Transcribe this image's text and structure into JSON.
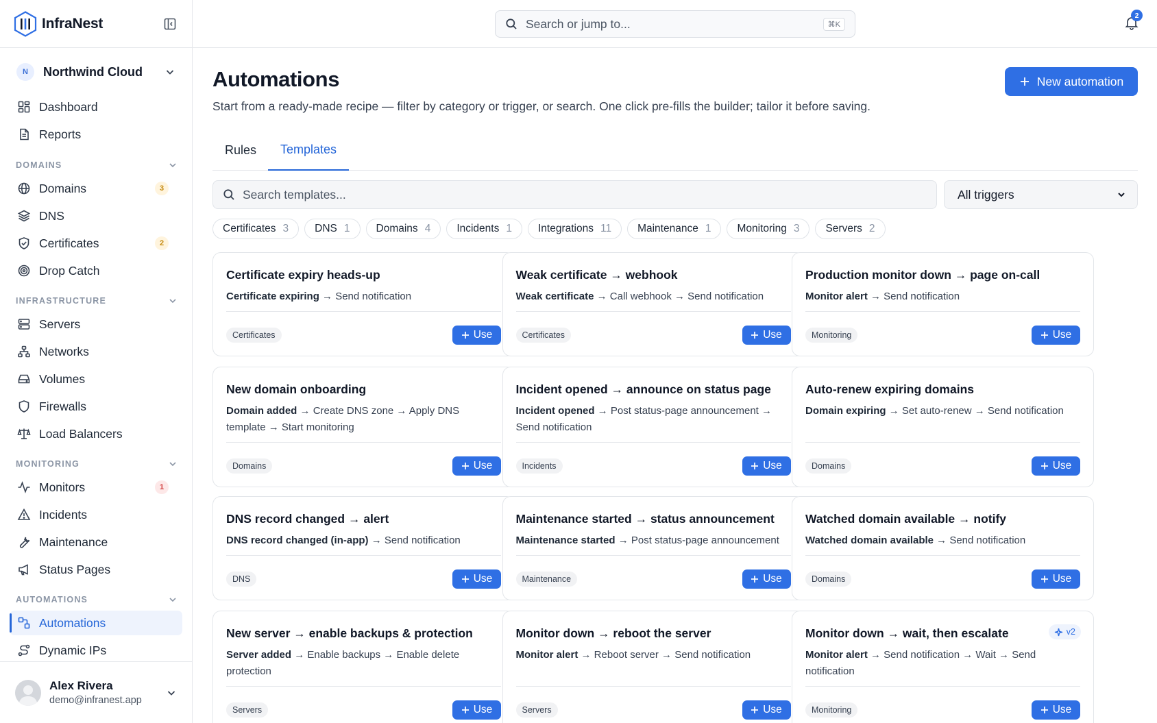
{
  "brand": {
    "name": "InfraNest"
  },
  "org": {
    "initial": "N",
    "name": "Northwind Cloud"
  },
  "nav": {
    "dashboard": "Dashboard",
    "reports": "Reports",
    "domains_section": "DOMAINS",
    "domains": "Domains",
    "domains_count": "3",
    "dns": "DNS",
    "certificates": "Certificates",
    "certificates_count": "2",
    "drop_catch": "Drop Catch",
    "infrastructure_section": "INFRASTRUCTURE",
    "servers": "Servers",
    "networks": "Networks",
    "volumes": "Volumes",
    "firewalls": "Firewalls",
    "load_balancers": "Load Balancers",
    "monitoring_section": "MONITORING",
    "monitors": "Monitors",
    "monitors_count": "1",
    "incidents": "Incidents",
    "maintenance": "Maintenance",
    "status_pages": "Status Pages",
    "automations_section": "AUTOMATIONS",
    "automations": "Automations",
    "dynamic_ips": "Dynamic IPs"
  },
  "user": {
    "name": "Alex Rivera",
    "email": "demo@infranest.app"
  },
  "topbar": {
    "search_placeholder": "Search or jump to...",
    "shortcut": "⌘K",
    "notifications_count": "2"
  },
  "page": {
    "title": "Automations",
    "subtitle": "Start from a ready-made recipe — filter by category or trigger, or search. One click pre-fills the builder; tailor it before saving.",
    "new_button": "New automation",
    "tabs": [
      "Rules",
      "Templates"
    ],
    "active_tab": "Templates",
    "template_search_placeholder": "Search templates...",
    "trigger_filter": "All triggers"
  },
  "chips": [
    {
      "label": "Certificates",
      "count": "3"
    },
    {
      "label": "DNS",
      "count": "1"
    },
    {
      "label": "Domains",
      "count": "4"
    },
    {
      "label": "Incidents",
      "count": "1"
    },
    {
      "label": "Integrations",
      "count": "11"
    },
    {
      "label": "Maintenance",
      "count": "1"
    },
    {
      "label": "Monitoring",
      "count": "3"
    },
    {
      "label": "Servers",
      "count": "2"
    }
  ],
  "use_label": "Use",
  "cards": [
    {
      "title": "Certificate expiry heads-up",
      "trigger": "Certificate expiring",
      "steps": " → Send notification",
      "tag": "Certificates"
    },
    {
      "title": "Weak certificate → webhook",
      "trigger": "Weak certificate",
      "steps": " → Call webhook → Send notification",
      "tag": "Certificates"
    },
    {
      "title": "Production monitor down → page on-call",
      "trigger": "Monitor alert",
      "steps": " → Send notification",
      "tag": "Monitoring"
    },
    {
      "title": "New domain onboarding",
      "trigger": "Domain added",
      "steps": " → Create DNS zone → Apply DNS template → Start monitoring",
      "tag": "Domains"
    },
    {
      "title": "Incident opened → announce on status page",
      "trigger": "Incident opened",
      "steps": " → Post status-page announcement → Send notification",
      "tag": "Incidents"
    },
    {
      "title": "Auto-renew expiring domains",
      "trigger": "Domain expiring",
      "steps": " → Set auto-renew → Send notification",
      "tag": "Domains"
    },
    {
      "title": "DNS record changed → alert",
      "trigger": "DNS record changed (in-app)",
      "steps": " → Send notification",
      "tag": "DNS"
    },
    {
      "title": "Maintenance started → status announcement",
      "trigger": "Maintenance started",
      "steps": " → Post status-page announcement",
      "tag": "Maintenance"
    },
    {
      "title": "Watched domain available → notify",
      "trigger": "Watched domain available",
      "steps": " → Send notification",
      "tag": "Domains"
    },
    {
      "title": "New server → enable backups & protection",
      "trigger": "Server added",
      "steps": " → Enable backups → Enable delete protection",
      "tag": "Servers"
    },
    {
      "title": "Monitor down → reboot the server",
      "trigger": "Monitor alert",
      "steps": " → Reboot server → Send notification",
      "tag": "Servers"
    },
    {
      "title": "Monitor down → wait, then escalate",
      "trigger": "Monitor alert",
      "steps": " → Send notification → Wait → Send notification",
      "tag": "Monitoring",
      "badge": "v2"
    }
  ],
  "colors": {
    "accent": "#2f6fe4",
    "amber_badge": "#c58a0f",
    "red_badge": "#d14040"
  }
}
